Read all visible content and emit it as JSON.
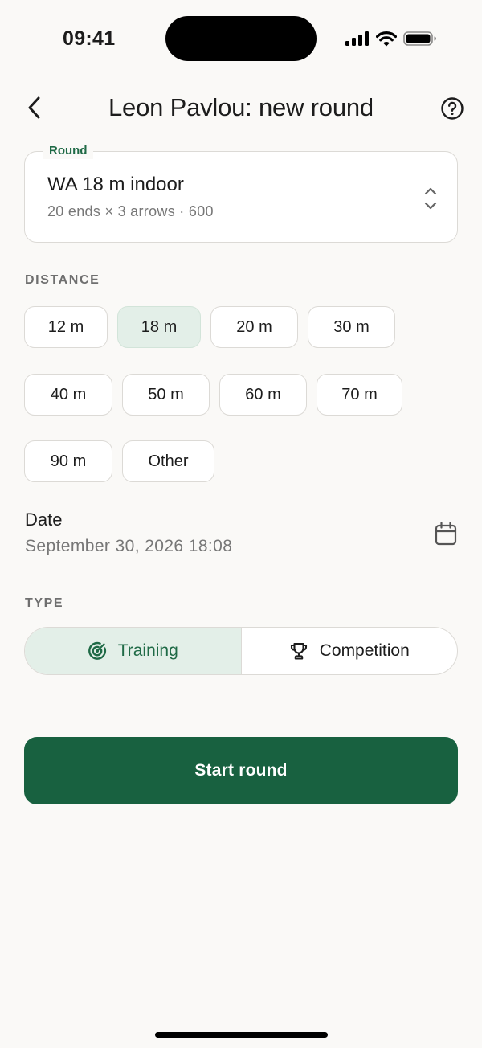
{
  "status_bar": {
    "time": "09:41"
  },
  "header": {
    "title": "Leon Pavlou: new round",
    "back_icon": "chevron-left-icon",
    "help_icon": "question-circle-icon"
  },
  "round": {
    "legend": "Round",
    "value": "WA 18 m indoor",
    "details": "20 ends × 3 arrows · 600"
  },
  "distance": {
    "label": "DISTANCE",
    "options": [
      "12 m",
      "18 m",
      "20 m",
      "30 m",
      "40 m",
      "50 m",
      "60 m",
      "70 m",
      "90 m",
      "Other"
    ],
    "selected": "18 m"
  },
  "date": {
    "label": "Date",
    "value": "September 30, 2026 18:08",
    "icon": "calendar-icon"
  },
  "type": {
    "label": "TYPE",
    "options": [
      {
        "label": "Training",
        "icon": "target-icon"
      },
      {
        "label": "Competition",
        "icon": "trophy-icon"
      }
    ],
    "selected": "Training"
  },
  "actions": {
    "start_label": "Start round"
  },
  "colors": {
    "accent": "#186140",
    "accent_soft": "#e3efe8",
    "background": "#faf9f7"
  }
}
